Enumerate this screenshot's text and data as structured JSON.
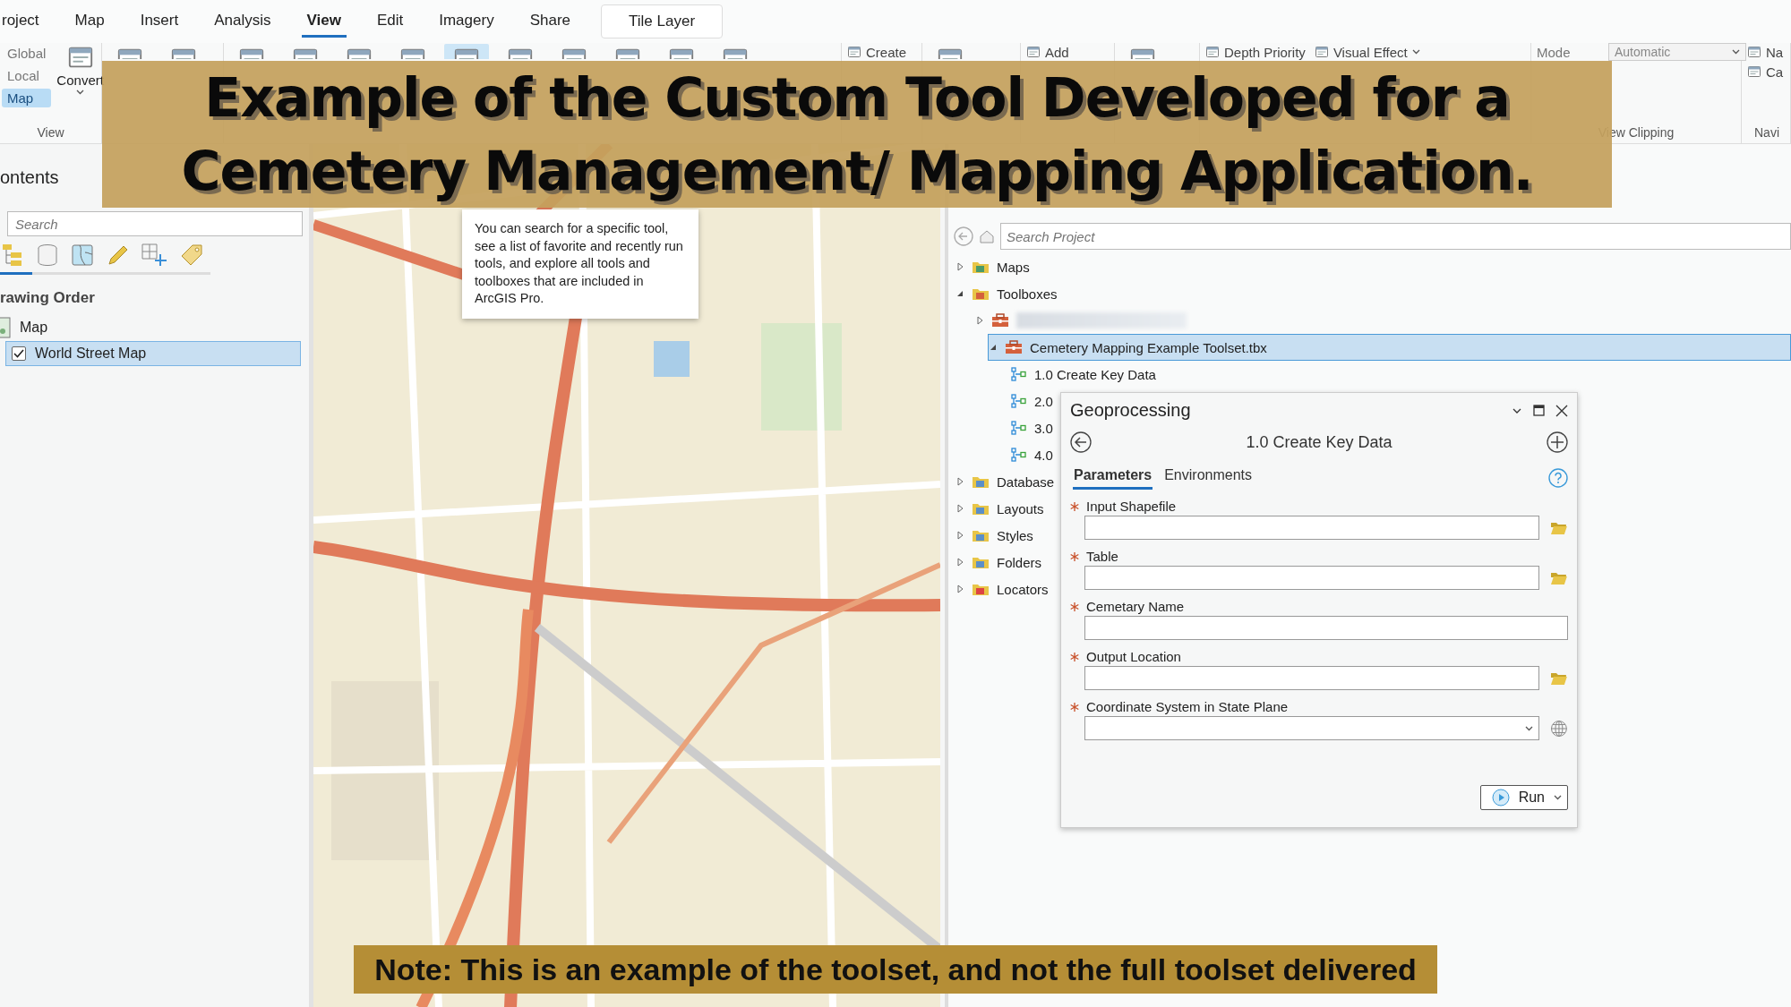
{
  "ribbon": {
    "tabs": [
      {
        "label": "roject",
        "selected": false,
        "kind": "tab"
      },
      {
        "label": "Map",
        "selected": false,
        "kind": "tab"
      },
      {
        "label": "Insert",
        "selected": false,
        "kind": "tab"
      },
      {
        "label": "Analysis",
        "selected": false,
        "kind": "tab"
      },
      {
        "label": "View",
        "selected": true,
        "kind": "tab"
      },
      {
        "label": "Edit",
        "selected": false,
        "kind": "tab"
      },
      {
        "label": "Imagery",
        "selected": false,
        "kind": "tab"
      },
      {
        "label": "Share",
        "selected": false,
        "kind": "tab"
      },
      {
        "label": "Tile Layer",
        "selected": false,
        "kind": "contextual"
      }
    ],
    "groups": [
      {
        "label": "View",
        "items": [
          {
            "kind": "option",
            "label": "Global",
            "selected": false
          },
          {
            "kind": "option",
            "label": "Local",
            "selected": false
          },
          {
            "kind": "option",
            "label": "Map",
            "selected": true
          },
          {
            "kind": "large",
            "label": "Convert",
            "dropdown": true
          }
        ]
      },
      {
        "items": [
          {
            "kind": "icon"
          },
          {
            "kind": "icon"
          }
        ]
      },
      {
        "items": [
          {
            "kind": "icon",
            "selected": false
          },
          {
            "kind": "icon",
            "selected": false
          },
          {
            "kind": "icon",
            "selected": false
          },
          {
            "kind": "icon",
            "selected": false
          },
          {
            "kind": "icon",
            "selected": true
          },
          {
            "kind": "icon",
            "selected": false
          },
          {
            "kind": "icon",
            "selected": false
          },
          {
            "kind": "icon",
            "selected": false
          },
          {
            "kind": "icon",
            "selected": false
          },
          {
            "kind": "icon",
            "selected": false
          }
        ]
      },
      {
        "items": [
          {
            "kind": "small",
            "label": "Create"
          }
        ]
      },
      {
        "items": [
          {
            "kind": "icon"
          }
        ]
      },
      {
        "items": [
          {
            "kind": "small",
            "label": "Add"
          }
        ]
      },
      {
        "items": [
          {
            "kind": "icon"
          }
        ]
      },
      {
        "items": [
          {
            "kind": "small",
            "label": "Depth Priority"
          },
          {
            "kind": "small",
            "label": "Visual Effect",
            "dropdown": true
          }
        ]
      },
      {
        "label": "View Clipping",
        "items": [
          {
            "kind": "field",
            "label": "Mode",
            "value": "Automatic"
          }
        ]
      },
      {
        "label": "Navi",
        "items": [
          {
            "kind": "small",
            "label": "Na"
          },
          {
            "kind": "small",
            "label": "Ca"
          }
        ]
      }
    ]
  },
  "banner": {
    "lines": [
      "Example of the Custom Tool Developed for a",
      "Cemetery Management/ Mapping Application."
    ]
  },
  "contents": {
    "title": "ontents",
    "search": {
      "placeholder": "Search"
    },
    "section": "rawing Order",
    "items": [
      {
        "label": "Map",
        "kind": "map"
      },
      {
        "label": "World Street Map",
        "kind": "layer",
        "checked": true,
        "selected": true
      }
    ]
  },
  "map": {
    "kind": "picture",
    "tooltip": "You can search for a specific tool, see a list of favorite and recently run tools, and explore all tools and toolboxes that are included in ArcGIS Pro."
  },
  "project": {
    "search": {
      "placeholder": "Search Project"
    },
    "tree": [
      {
        "label": "Maps",
        "kind": "maps",
        "expanded": false,
        "selected": false
      },
      {
        "label": "Toolboxes",
        "kind": "toolboxes",
        "expanded": true,
        "selected": false,
        "children": [
          {
            "kind": "hidden-toolbox",
            "expanded": false,
            "selected": false
          },
          {
            "label": "Cemetery Mapping Example Toolset.tbx",
            "kind": "toolbox",
            "expanded": true,
            "selected": true,
            "children": [
              {
                "label": "1.0 Create Key Data",
                "kind": "tool",
                "selected": false
              },
              {
                "label": "2.0",
                "kind": "tool",
                "selected": false
              },
              {
                "label": "3.0",
                "kind": "tool",
                "selected": false
              },
              {
                "label": "4.0",
                "kind": "tool",
                "selected": false
              }
            ]
          }
        ]
      },
      {
        "label": "Database",
        "kind": "databases",
        "expanded": false,
        "selected": false
      },
      {
        "label": "Layouts",
        "kind": "layouts",
        "expanded": false,
        "selected": false
      },
      {
        "label": "Styles",
        "kind": "styles",
        "expanded": false,
        "selected": false
      },
      {
        "label": "Folders",
        "kind": "folders",
        "expanded": false,
        "selected": false
      },
      {
        "label": "Locators",
        "kind": "locators",
        "expanded": false,
        "selected": false
      }
    ]
  },
  "geoprocessing": {
    "title": "Geoprocessing",
    "tool": "1.0 Create Key Data",
    "tabs": [
      {
        "label": "Parameters",
        "selected": true
      },
      {
        "label": "Environments",
        "selected": false
      }
    ],
    "parameters": [
      {
        "label": "Input Shapefile",
        "required": true,
        "kind": "file"
      },
      {
        "label": "Table",
        "required": true,
        "kind": "file"
      },
      {
        "label": "Cemetary Name",
        "required": true,
        "kind": "text"
      },
      {
        "label": "Output Location",
        "required": true,
        "kind": "file"
      },
      {
        "label": "Coordinate System in State Plane",
        "required": true,
        "kind": "coordinate"
      }
    ],
    "run": "Run"
  },
  "note": "Note: This is an example of the toolset, and not the full toolset delivered"
}
